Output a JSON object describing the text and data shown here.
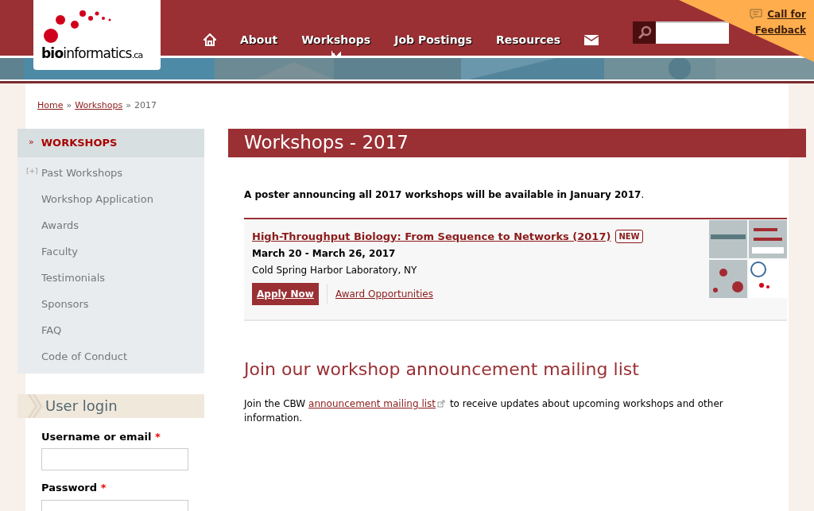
{
  "logo": {
    "bold": "bio",
    "rest": "informatics",
    "suffix": ".ca"
  },
  "nav": [
    {
      "kind": "home",
      "selected": false
    },
    {
      "kind": "text",
      "label": "About",
      "selected": false
    },
    {
      "kind": "text",
      "label": "Workshops",
      "selected": true
    },
    {
      "kind": "text",
      "label": "Job Postings",
      "selected": false
    },
    {
      "kind": "text",
      "label": "Resources",
      "selected": false
    },
    {
      "kind": "mail",
      "selected": false
    }
  ],
  "feedback": {
    "line1": "Call for",
    "line2": "Feedback"
  },
  "breadcrumb": {
    "links": [
      "Home",
      "Workshops"
    ],
    "separator": "»",
    "current": "2017"
  },
  "sidebar": {
    "marker": "»",
    "title": "WORKSHOPS",
    "items": [
      {
        "label": "Past Workshops",
        "toggle": "[+]",
        "expanded": false
      },
      {
        "label": "Workshop Application"
      },
      {
        "label": "Awards"
      },
      {
        "label": "Faculty"
      },
      {
        "label": "Testimonials"
      },
      {
        "label": "Sponsors"
      },
      {
        "label": "FAQ"
      },
      {
        "label": "Code of Conduct"
      }
    ]
  },
  "login": {
    "title": "User login",
    "required_mark": "*",
    "fields": [
      {
        "label": "Username or email"
      },
      {
        "label": "Password"
      }
    ]
  },
  "page_title": "Workshops - 2017",
  "intro": "**A poster announcing all 2017 workshops will be available in January 2017**.",
  "workshops": [
    {
      "title": "High-Throughput Biology: From Sequence to Networks (2017)",
      "badge": "NEW",
      "dates": "March 20 - March 26, 2017",
      "location": "Cold Spring Harbor Laboratory, NY",
      "apply": "Apply Now",
      "awards": "Award Opportunities"
    }
  ],
  "mailing": {
    "heading": "Join our workshop announcement mailing list",
    "before": "Join the CBW",
    "link": "announcement mailing list",
    "after": "to receive updates about upcoming workshops and other information."
  }
}
